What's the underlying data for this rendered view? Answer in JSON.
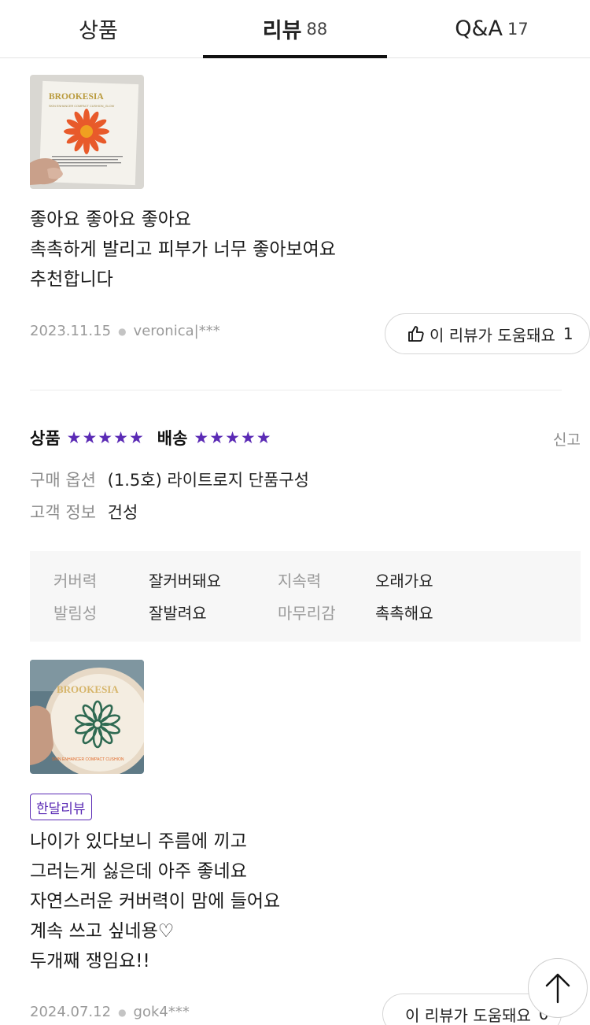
{
  "tabs": [
    {
      "label": "상품",
      "count": ""
    },
    {
      "label": "리뷰",
      "count": "88"
    },
    {
      "label": "Q&A",
      "count": "17"
    }
  ],
  "review1": {
    "image_brand": "BROOKESIA",
    "image_subtitle": "SKIN ENHANCER COMPACT CUSHION_GLOW",
    "text_lines": [
      "좋아요 좋아요 좋아요",
      "촉촉하게 발리고 피부가 너무 좋아보여요",
      "추천합니다"
    ],
    "date": "2023.11.15",
    "author": "veronica|***",
    "helpful_label": "이 리뷰가 도움돼요",
    "helpful_count": "1"
  },
  "review2": {
    "product_label": "상품",
    "product_stars": 5,
    "delivery_label": "배송",
    "delivery_stars": 5,
    "report_label": "신고",
    "purchase_option_key": "구매 옵션",
    "purchase_option_value": "(1.5호) 라이트로지 단품구성",
    "customer_info_key": "고객 정보",
    "customer_info_value": "건성",
    "attributes": [
      {
        "key": "커버력",
        "value": "잘커버돼요"
      },
      {
        "key": "지속력",
        "value": "오래가요"
      },
      {
        "key": "발림성",
        "value": "잘발려요"
      },
      {
        "key": "마무리감",
        "value": "촉촉해요"
      }
    ],
    "image_brand": "BROOKESIA",
    "image_subtitle": "SKIN ENHANCER COMPACT CUSHION",
    "badge": "한달리뷰",
    "text_lines": [
      "나이가 있다보니 주름에 끼고",
      "그러는게 싫은데 아주 좋네요",
      "자연스러운 커버력이 맘에 들어요",
      "계속 쓰고 싶네용♡",
      "두개째 쟁임요!!"
    ],
    "date": "2024.07.12",
    "author": "gok4***",
    "helpful_label": "이 리뷰가 도움돼요",
    "helpful_count": "0"
  },
  "colors": {
    "accent_purple": "#5b2bb5",
    "active_tab_underline": "#111111",
    "muted_text": "#9a9a9a"
  },
  "icons": [
    "thumbs-up-icon",
    "star-icon",
    "arrow-up-icon"
  ]
}
